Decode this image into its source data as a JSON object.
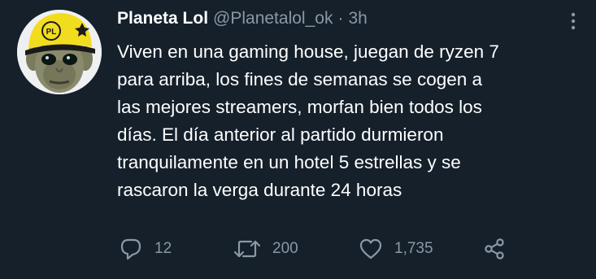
{
  "author": {
    "display_name": "Planeta Lol",
    "handle": "@Planetalol_ok",
    "separator": "·",
    "time": "3h",
    "avatar_badge": "PL"
  },
  "tweet": {
    "text": "Viven en una gaming house, juegan de ryzen 7\npara arriba, los fines de semanas se cogen a\nlas mejores streamers, morfan bien todos los\ndías. El día anterior al partido durmieron\ntranquilamente en un hotel 5 estrellas y se\nrascaron la verga durante 24 horas"
  },
  "actions": {
    "replies": "12",
    "retweets": "200",
    "likes": "1,735"
  },
  "icons": {
    "reply": "reply-icon",
    "retweet": "retweet-icon",
    "like": "heart-icon",
    "share": "share-icon",
    "more": "more-icon"
  },
  "colors": {
    "background": "#15202b",
    "text": "#ffffff",
    "secondary": "#8b98a5",
    "avatar_hat": "#f2dc1e"
  }
}
